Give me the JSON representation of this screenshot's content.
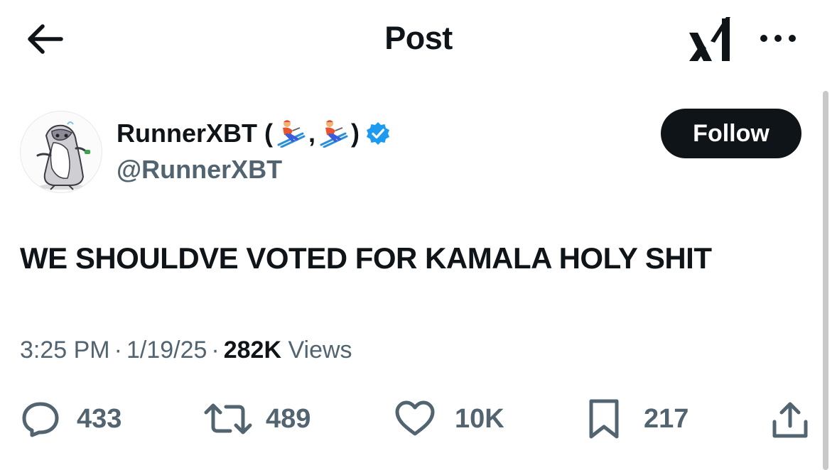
{
  "header": {
    "title": "Post",
    "back_icon": "arrow-left-icon",
    "logo_icon": "xai-logo-icon",
    "more_icon": "more-horizontal-icon"
  },
  "author": {
    "display_name_prefix": "RunnerXBT (",
    "display_name_separator": ",",
    "display_name_suffix": ")",
    "name_emoji_icon": "skier-emoji-icon",
    "handle": "@RunnerXBT",
    "verified_icon": "verified-badge-icon",
    "verified_color": "#1d9bf0"
  },
  "follow": {
    "label": "Follow"
  },
  "tweet": {
    "text": "WE SHOULDVE VOTED FOR KAMALA HOLY SHIT"
  },
  "meta": {
    "time": "3:25 PM",
    "separator": "·",
    "date": "1/19/25",
    "views_count": "282K",
    "views_label": "Views"
  },
  "actions": {
    "replies": {
      "icon": "reply-icon",
      "count": "433"
    },
    "reposts": {
      "icon": "repost-icon",
      "count": "489"
    },
    "likes": {
      "icon": "heart-icon",
      "count": "10K"
    },
    "bookmarks": {
      "icon": "bookmark-icon",
      "count": "217"
    },
    "share": {
      "icon": "share-icon"
    }
  },
  "colors": {
    "text_primary": "#0f1419",
    "text_secondary": "#536471",
    "follow_bg": "#0f1419",
    "background": "#ffffff"
  }
}
